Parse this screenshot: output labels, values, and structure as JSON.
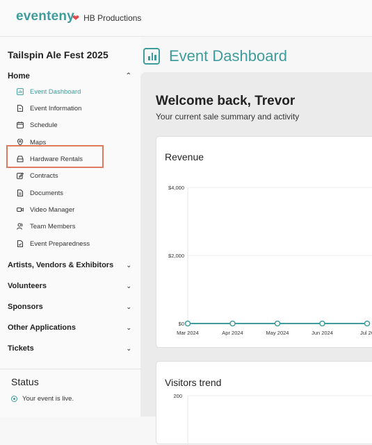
{
  "header": {
    "logo_text": "eventeny",
    "org_name": "HB Productions",
    "heart_icon": "heart-icon"
  },
  "sidebar": {
    "event_name": "Tailspin Ale Fest 2025",
    "home_label": "Home",
    "home_items": [
      {
        "label": "Event Dashboard",
        "icon": "bar-chart-icon",
        "active": true
      },
      {
        "label": "Event Information",
        "icon": "document-icon"
      },
      {
        "label": "Schedule",
        "icon": "calendar-icon"
      },
      {
        "label": "Maps",
        "icon": "map-pin-icon"
      },
      {
        "label": "Hardware Rentals",
        "icon": "hardware-icon",
        "highlighted": true
      },
      {
        "label": "Contracts",
        "icon": "edit-icon"
      },
      {
        "label": "Documents",
        "icon": "document-icon"
      },
      {
        "label": "Video Manager",
        "icon": "video-icon"
      },
      {
        "label": "Team Members",
        "icon": "team-icon"
      },
      {
        "label": "Event Preparedness",
        "icon": "checklist-icon"
      }
    ],
    "sections": [
      {
        "label": "Artists, Vendors & Exhibitors"
      },
      {
        "label": "Volunteers"
      },
      {
        "label": "Sponsors"
      },
      {
        "label": "Other Applications"
      },
      {
        "label": "Tickets"
      }
    ],
    "status": {
      "title": "Status",
      "text": "Your event is live."
    }
  },
  "main": {
    "page_title": "Event Dashboard",
    "welcome": "Welcome back, Trevor",
    "subtitle": "Your current sale summary and activity",
    "revenue_title": "Revenue",
    "visitors_title": "Visitors trend",
    "accent_color": "#3f9c9c"
  },
  "chart_data": [
    {
      "type": "line",
      "title": "Revenue",
      "categories": [
        "Mar 2024",
        "Apr 2024",
        "May 2024",
        "Jun 2024",
        "Jul 20"
      ],
      "series": [
        {
          "values": [
            0,
            0,
            0,
            0,
            0
          ]
        }
      ],
      "yticks": [
        "$0",
        "$2,000",
        "$4,000"
      ],
      "ylim": [
        0,
        4000
      ],
      "grid": true
    },
    {
      "type": "line",
      "title": "Visitors trend",
      "yticks": [
        "200"
      ],
      "series": []
    }
  ]
}
